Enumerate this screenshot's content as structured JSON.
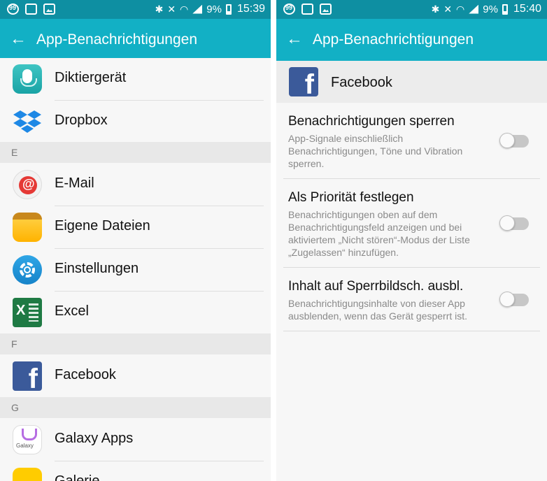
{
  "left": {
    "status": {
      "battery": "9%",
      "time": "15:39"
    },
    "appbar": {
      "title": "App-Benachrichtigungen"
    },
    "list": [
      {
        "type": "item",
        "label": "Diktiergerät",
        "icon": "voice-recorder-icon"
      },
      {
        "type": "item",
        "label": "Dropbox",
        "icon": "dropbox-icon"
      },
      {
        "type": "section",
        "label": "E"
      },
      {
        "type": "item",
        "label": "E-Mail",
        "icon": "email-icon"
      },
      {
        "type": "item",
        "label": "Eigene Dateien",
        "icon": "folder-icon"
      },
      {
        "type": "item",
        "label": "Einstellungen",
        "icon": "settings-gear-icon"
      },
      {
        "type": "item",
        "label": "Excel",
        "icon": "excel-icon"
      },
      {
        "type": "section",
        "label": "F"
      },
      {
        "type": "item",
        "label": "Facebook",
        "icon": "facebook-icon"
      },
      {
        "type": "section",
        "label": "G"
      },
      {
        "type": "item",
        "label": "Galaxy Apps",
        "icon": "galaxy-apps-icon"
      },
      {
        "type": "item",
        "label": "Galerie",
        "icon": "gallery-icon"
      }
    ]
  },
  "right": {
    "status": {
      "battery": "9%",
      "time": "15:40"
    },
    "appbar": {
      "title": "App-Benachrichtigungen"
    },
    "app": {
      "name": "Facebook",
      "icon": "facebook-icon"
    },
    "settings": [
      {
        "title": "Benachrichtigungen sperren",
        "description": "App-Signale einschließlich Benachrichtigungen, Töne und Vibration sperren.",
        "enabled": false
      },
      {
        "title": "Als Priorität festlegen",
        "description": "Benachrichtigungen oben auf dem Benachrichtigungsfeld anzeigen und bei aktiviertem „Nicht stören“-Modus der Liste „Zugelassen“ hinzufügen.",
        "enabled": false
      },
      {
        "title": "Inhalt auf Sperrbildsch. ausbl.",
        "description": "Benachrichtigungsinhalte von dieser App ausblenden, wenn das Gerät gesperrt ist.",
        "enabled": false
      }
    ]
  },
  "colors": {
    "statusbar": "#0e8fa2",
    "appbar": "#12b0c5",
    "section": "#e8e8e8",
    "toggle_off": "#c7c7c7"
  }
}
